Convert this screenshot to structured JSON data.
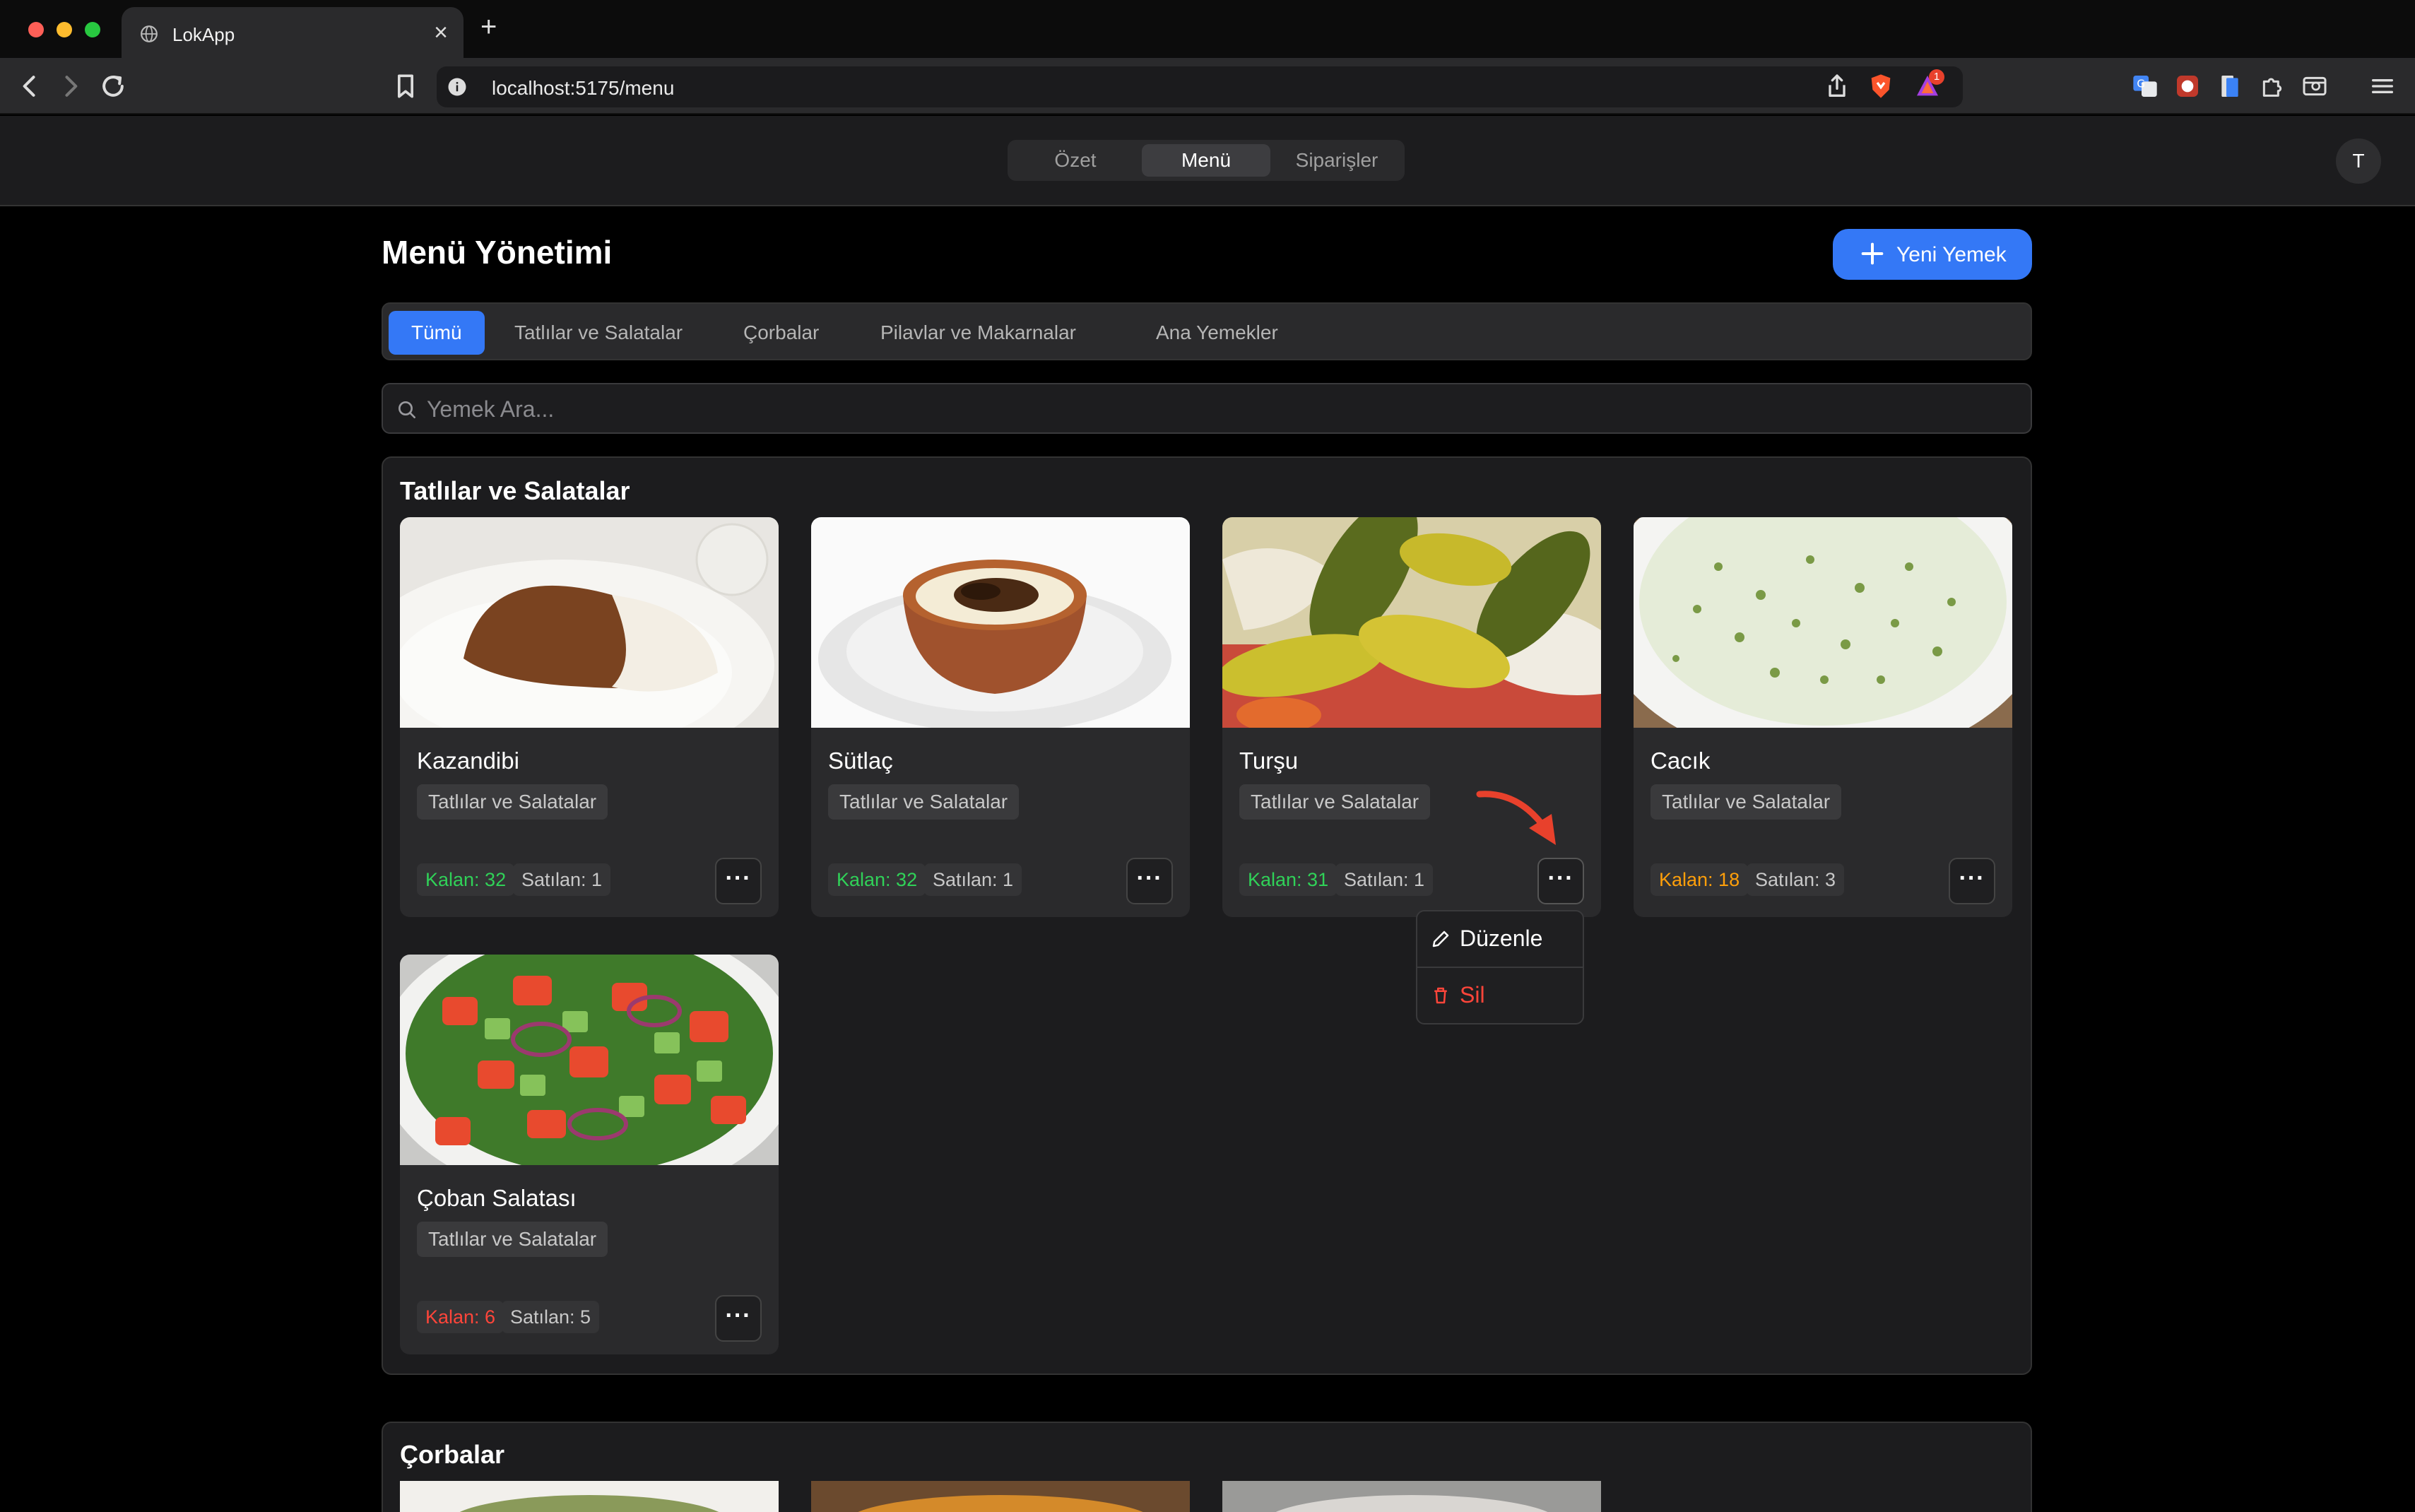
{
  "browser": {
    "tab_title": "LokApp",
    "new_tab_symbol": "+",
    "close_symbol": "×",
    "url": "localhost:5175/menu",
    "notification_count": "1"
  },
  "app": {
    "nav": [
      "Özet",
      "Menü",
      "Siparişler"
    ],
    "active_nav": "Menü",
    "avatar_initial": "T"
  },
  "page": {
    "title": "Menü Yönetimi",
    "new_button": "Yeni Yemek",
    "search_placeholder": "Yemek Ara..."
  },
  "categories": [
    "Tümü",
    "Tatlılar ve Salatalar",
    "Çorbalar",
    "Pilavlar ve Makarnalar",
    "Ana Yemekler"
  ],
  "active_category": "Tümü",
  "sections": [
    {
      "title": "Tatlılar ve Salatalar",
      "items": [
        {
          "name": "Kazandibi",
          "category": "Tatlılar ve Salatalar",
          "stock": "Kalan: 32",
          "sold": "Satılan: 1",
          "stock_level": "green"
        },
        {
          "name": "Sütlaç",
          "category": "Tatlılar ve Salatalar",
          "stock": "Kalan: 32",
          "sold": "Satılan: 1",
          "stock_level": "green"
        },
        {
          "name": "Turşu",
          "category": "Tatlılar ve Salatalar",
          "stock": "Kalan: 31",
          "sold": "Satılan: 1",
          "stock_level": "green"
        },
        {
          "name": "Cacık",
          "category": "Tatlılar ve Salatalar",
          "stock": "Kalan: 18",
          "sold": "Satılan: 3",
          "stock_level": "orange"
        },
        {
          "name": "Çoban Salatası",
          "category": "Tatlılar ve Salatalar",
          "stock": "Kalan: 6",
          "sold": "Satılan: 5",
          "stock_level": "red"
        }
      ]
    },
    {
      "title": "Çorbalar",
      "items": []
    }
  ],
  "context_menu": {
    "edit": "Düzenle",
    "delete": "Sil"
  },
  "more_symbol": "···",
  "colors": {
    "accent": "#3478f6",
    "stock_green": "#30d158",
    "stock_orange": "#ff9f0a",
    "stock_red": "#ff453a",
    "arrow": "#e8412c"
  }
}
